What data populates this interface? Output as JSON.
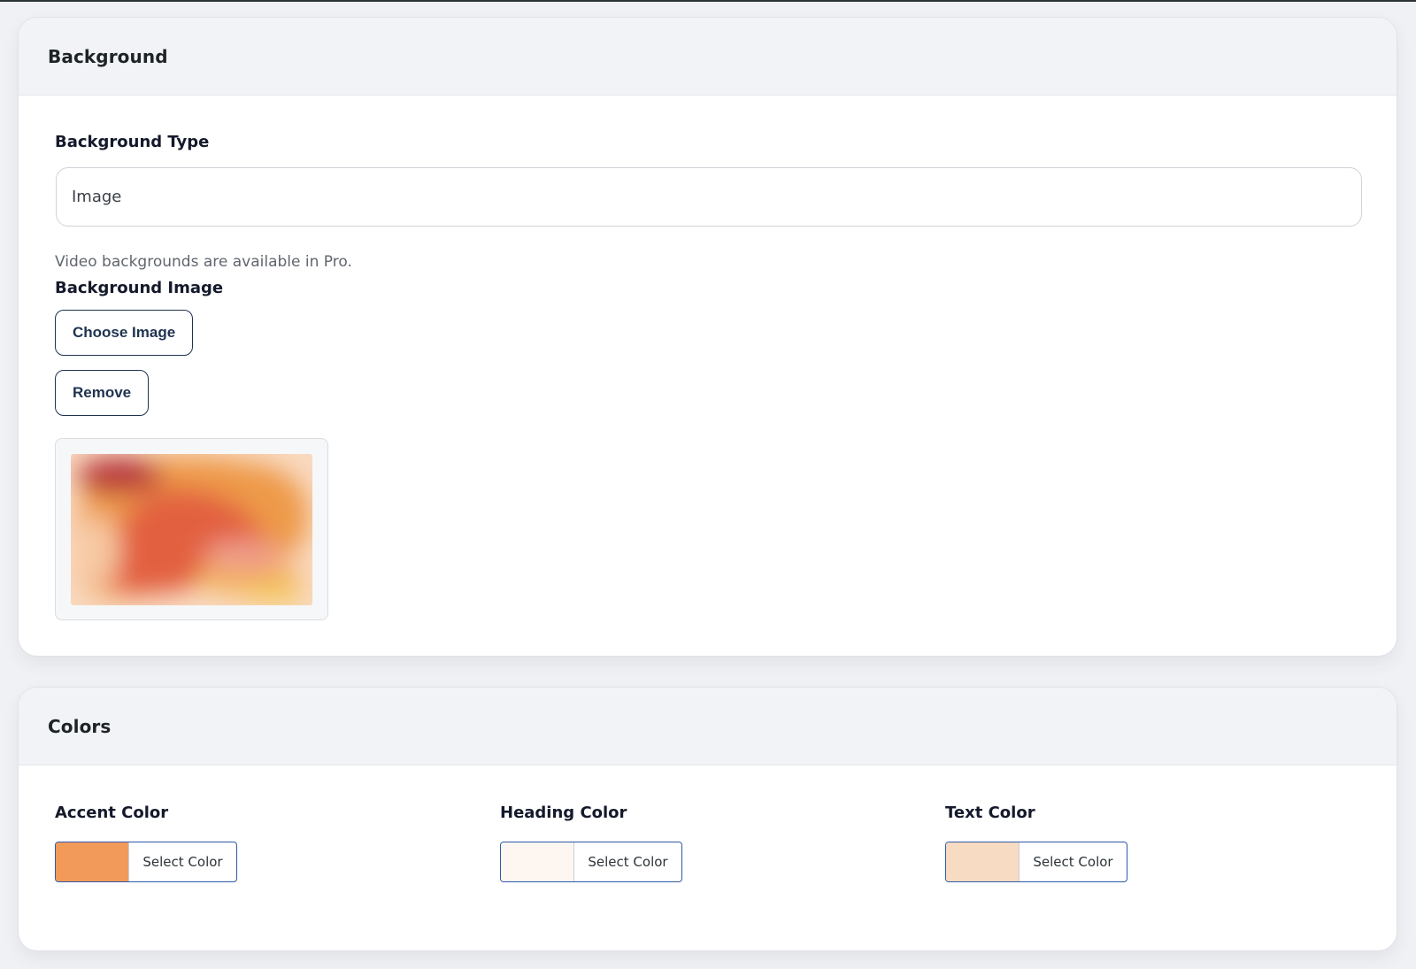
{
  "background_section": {
    "title": "Background",
    "type_label": "Background Type",
    "type_value": "Image",
    "help_text": "Video backgrounds are available in Pro.",
    "image_label": "Background Image",
    "choose_button": "Choose Image",
    "remove_button": "Remove"
  },
  "colors_section": {
    "title": "Colors",
    "pickers": [
      {
        "label": "Accent Color",
        "button": "Select Color",
        "color": "#f29a5a"
      },
      {
        "label": "Heading Color",
        "button": "Select Color",
        "color": "#fdf6f1"
      },
      {
        "label": "Text Color",
        "button": "Select Color",
        "color": "#f8dbc3"
      }
    ]
  }
}
